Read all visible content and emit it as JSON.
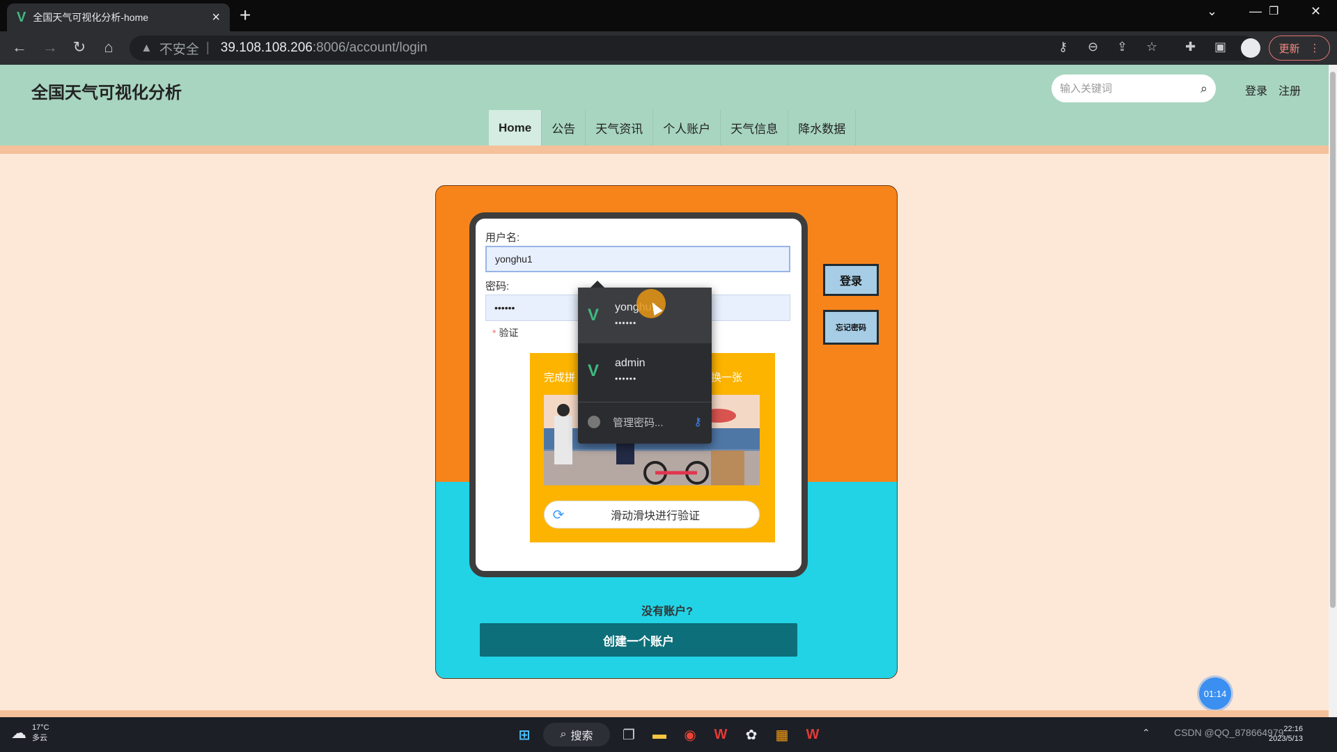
{
  "browser": {
    "tab_title": "全国天气可视化分析-home",
    "tab_favicon": "V",
    "url_warning": "不安全",
    "url_host": "39.108.108.206",
    "url_path": ":8006/account/login",
    "update_label": "更新"
  },
  "header": {
    "site_title": "全国天气可视化分析",
    "search_placeholder": "输入关键词",
    "login_link": "登录",
    "register_link": "注册"
  },
  "nav": {
    "items": [
      "Home",
      "公告",
      "天气资讯",
      "个人账户",
      "天气信息",
      "降水数据"
    ],
    "active": "Home"
  },
  "login_form": {
    "username_label": "用户名:",
    "username_value": "yonghu1",
    "password_label": "密码:",
    "password_value": "••••••",
    "verify_label": "验证",
    "captcha_hint": "完成拼",
    "captcha_refresh": "换一张",
    "slider_text": "滑动滑块进行验证",
    "login_button": "登录",
    "forgot_button": "忘记密码",
    "no_account_text": "没有账户?",
    "create_button": "创建一个账户"
  },
  "autofill": {
    "entries": [
      {
        "username": "yonghu1",
        "password": "••••••"
      },
      {
        "username": "admin",
        "password": "••••••"
      }
    ],
    "manage_label": "管理密码..."
  },
  "recording_timer": "01:14",
  "taskbar": {
    "weather_temp": "17°C",
    "weather_desc": "多云",
    "search_label": "搜索",
    "clock_time": "22:16",
    "clock_date": "2023/5/13",
    "watermark": "CSDN @QQ_878664979"
  },
  "colors": {
    "header_bg": "#a8d5c0",
    "page_bg": "#fde8d8",
    "card_orange": "#f7841a",
    "card_cyan": "#22d3e6",
    "create_button": "#0d6f79",
    "captcha_bg": "#fcb400"
  }
}
